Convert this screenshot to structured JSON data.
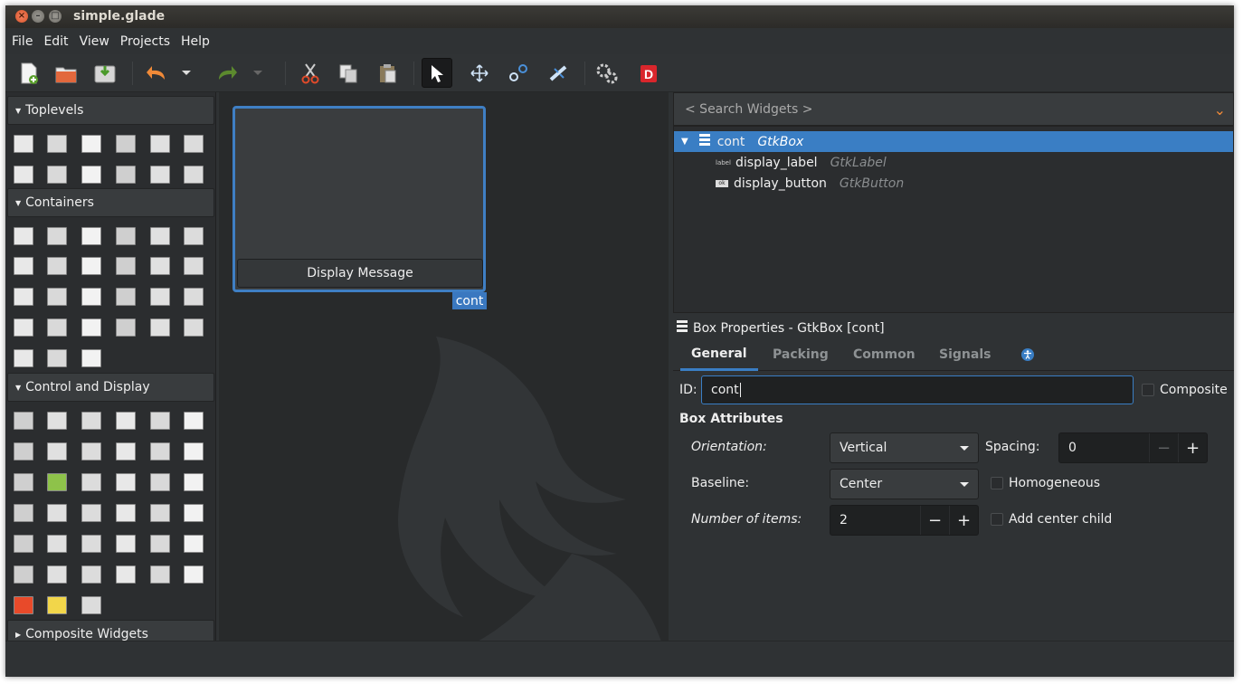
{
  "window": {
    "title": "simple.glade"
  },
  "menu": [
    "File",
    "Edit",
    "View",
    "Projects",
    "Help"
  ],
  "toolbar": {
    "icons": [
      "new-file-icon",
      "open-folder-icon",
      "save-icon",
      "undo-icon",
      "undo-dropdown-icon",
      "redo-icon",
      "redo-dropdown-icon",
      "cut-icon",
      "copy-icon",
      "paste-icon",
      "pointer-select-icon",
      "drag-resize-icon",
      "margin-edit-icon",
      "align-edit-icon",
      "preferences-gears-icon",
      "inspector-d-icon"
    ]
  },
  "palette": {
    "sections": [
      "Toplevels",
      "Containers",
      "Control and Display",
      "Composite Widgets"
    ]
  },
  "preview": {
    "button_label": "Display Message",
    "selection_tag": "cont"
  },
  "search": {
    "placeholder": "< Search Widgets >"
  },
  "tree": {
    "rows": [
      {
        "name": "cont",
        "type": "GtkBox"
      },
      {
        "name": "display_label",
        "type": "GtkLabel",
        "icon_text": "label"
      },
      {
        "name": "display_button",
        "type": "GtkButton",
        "icon_text": "ok"
      }
    ]
  },
  "props": {
    "header": "Box Properties - GtkBox [cont]",
    "tabs": [
      "General",
      "Packing",
      "Common",
      "Signals"
    ],
    "id_label": "ID:",
    "id_value": "cont",
    "composite_label": "Composite",
    "section_title": "Box Attributes",
    "orientation_label": "Orientation:",
    "orientation_value": "Vertical",
    "spacing_label": "Spacing:",
    "spacing_value": "0",
    "baseline_label": "Baseline:",
    "baseline_value": "Center",
    "homogeneous_label": "Homogeneous",
    "items_label": "Number of items:",
    "items_value": "2",
    "center_child_label": "Add center child",
    "minus": "−",
    "plus": "+"
  },
  "colors": {
    "accent": "#3a7ec4",
    "orange": "#f08a38",
    "background": "#2f3234"
  }
}
